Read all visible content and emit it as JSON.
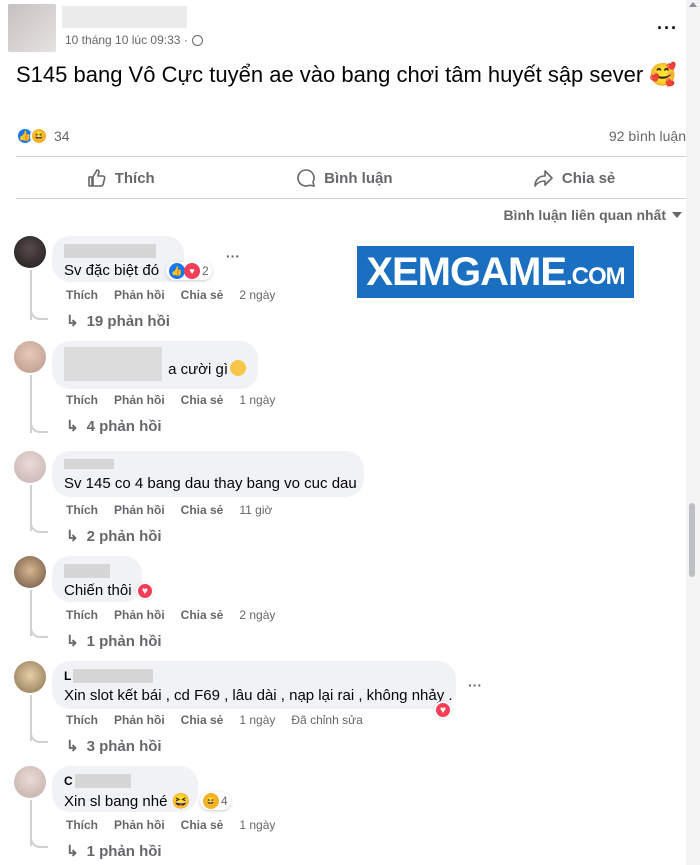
{
  "post": {
    "timestamp": "10 tháng 10 lúc 09:33 ·",
    "text": "S145 bang Vô Cực tuyển ae vào bang chơi tâm huyết sập sever 🥰",
    "reaction_count": "34",
    "comment_count": "92 bình luận"
  },
  "actions": {
    "like": "Thích",
    "comment": "Bình luận",
    "share": "Chia sẻ"
  },
  "sort_label": "Bình luận liên quan nhất",
  "watermark": {
    "main": "XEMGAME",
    "suffix": ".COM"
  },
  "comment_labels": {
    "like": "Thích",
    "reply": "Phản hồi",
    "share": "Chia sẻ"
  },
  "comments": [
    {
      "name_partial": "",
      "text": "Sv đặc biệt đó",
      "time": "2 ngày",
      "reactions": "2",
      "replies": "19 phản hồi"
    },
    {
      "name_partial": "",
      "text": "a cười gì",
      "time": "1 ngày",
      "reactions": "",
      "replies": "4 phản hồi"
    },
    {
      "name_partial": "",
      "text": "Sv 145 co 4 bang dau thay bang vo cuc dau",
      "time": "11 giờ",
      "reactions": "",
      "replies": "2 phản hồi"
    },
    {
      "name_partial": "",
      "text": "Chiến thôi",
      "time": "2 ngày",
      "reactions": "",
      "replies": "1 phản hồi"
    },
    {
      "name_partial": "L",
      "text": "Xin slot kết bái , cd F69 , lâu dài , nạp lại rai , không nhảy .",
      "time": "1 ngày",
      "edited": "Đã chỉnh sửa",
      "reactions": "",
      "replies": "3 phản hồi"
    },
    {
      "name_partial": "C",
      "text": "Xin sl bang nhé 😆",
      "time": "1 ngày",
      "reactions": "4",
      "replies": "1 phản hồi"
    }
  ],
  "colors": {
    "accent": "#1877f2",
    "muted": "#65676b",
    "bubble": "#f0f2f5",
    "watermark_bg": "#1a6fc0"
  }
}
